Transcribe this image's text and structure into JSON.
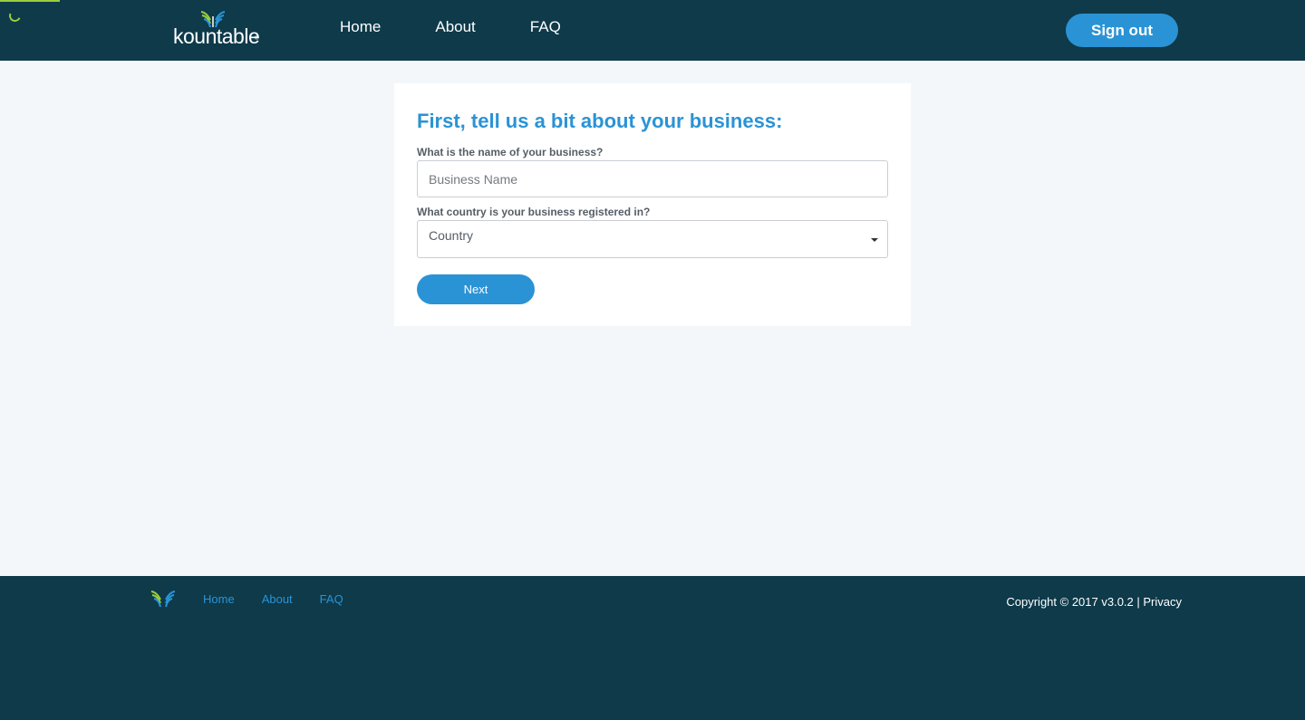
{
  "header": {
    "logo_text": "kountable",
    "logo_tm": "®",
    "logo_icon": "kountable-mark-icon",
    "nav": [
      {
        "label": "Home"
      },
      {
        "label": "About"
      },
      {
        "label": "FAQ"
      }
    ],
    "signout_label": "Sign out"
  },
  "loading": {
    "progress": 0.046
  },
  "form": {
    "title": "First, tell us a bit about your business:",
    "business_name_label": "What is the name of your business?",
    "business_name_placeholder": "Business Name",
    "business_name_value": "",
    "country_label": "What country is your business registered in?",
    "country_selected": "Country",
    "next_label": "Next"
  },
  "footer": {
    "logo_icon": "kountable-mark-icon",
    "nav": [
      {
        "label": "Home"
      },
      {
        "label": "About"
      },
      {
        "label": "FAQ"
      }
    ],
    "copyright": "Copyright © 2017 v3.0.2 |",
    "privacy_label": "Privacy"
  },
  "colors": {
    "header_bg": "#0e3a4a",
    "accent_blue": "#2a93d5",
    "accent_green": "#9acd3c",
    "page_bg": "#f4f7fa"
  }
}
